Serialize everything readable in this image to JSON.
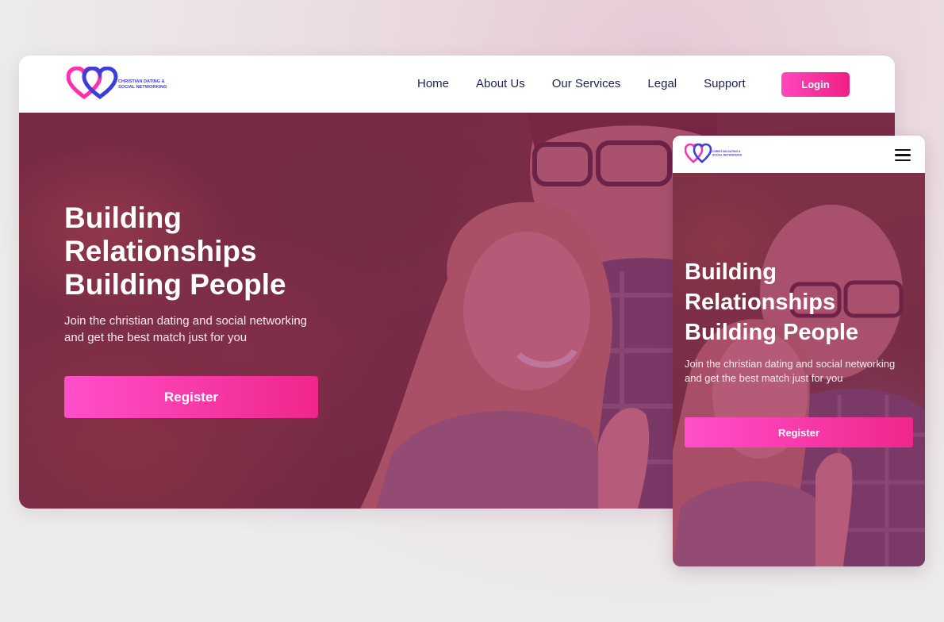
{
  "brand": {
    "logo_line1": "CHRISTIAN DATING &",
    "logo_line2": "SOCIAL NETWORKING",
    "colors": {
      "pink": "#ff2fb0",
      "blue": "#3b3fd8",
      "accent": "#f01f85",
      "navy": "#1b2250"
    }
  },
  "desktop": {
    "nav": {
      "items": [
        {
          "label": "Home"
        },
        {
          "label": "About Us"
        },
        {
          "label": "Our Services"
        },
        {
          "label": "Legal"
        },
        {
          "label": "Support"
        }
      ],
      "login_label": "Login"
    },
    "hero": {
      "headline_lines": [
        "Building",
        "Relationships",
        "Building People"
      ],
      "subtext_lines": [
        "Join the christian dating and social networking",
        "and get the best match just for you"
      ],
      "register_label": "Register"
    }
  },
  "mobile": {
    "menu_icon": "hamburger-menu-icon",
    "hero": {
      "headline_lines": [
        "Building",
        "Relationships",
        "Building People"
      ],
      "subtext_lines": [
        "Join the christian dating and social networking",
        "and get the best match just for you"
      ],
      "register_label": "Register"
    }
  }
}
